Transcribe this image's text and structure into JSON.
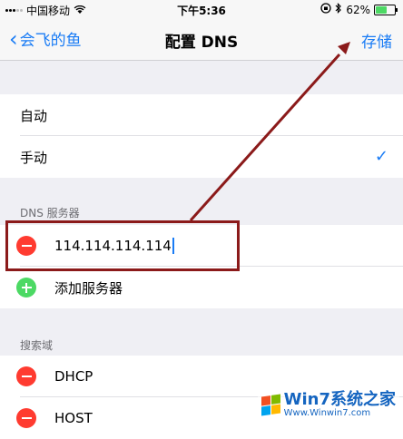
{
  "status_bar": {
    "carrier": "中国移动",
    "time": "下午5:36",
    "battery_text": "62%",
    "battery_level": 0.62
  },
  "nav": {
    "back_label": "会飞的鱼",
    "title": "配置 DNS",
    "save_label": "存储"
  },
  "mode_options": [
    {
      "label": "自动",
      "selected": false
    },
    {
      "label": "手动",
      "selected": true
    }
  ],
  "check_glyph": "✓",
  "dns_section": {
    "header": "DNS 服务器",
    "servers": [
      "114.114.114.114"
    ],
    "add_label": "添加服务器"
  },
  "search_section": {
    "header": "搜索域",
    "domains": [
      "DHCP",
      "HOST"
    ]
  },
  "watermark": {
    "title": "Win7系统之家",
    "url": "Www.Winwin7.com"
  },
  "colors": {
    "accent": "#1a7cf5",
    "delete": "#ff3b30",
    "add": "#4cd964",
    "annotation": "#8b1a1a"
  }
}
